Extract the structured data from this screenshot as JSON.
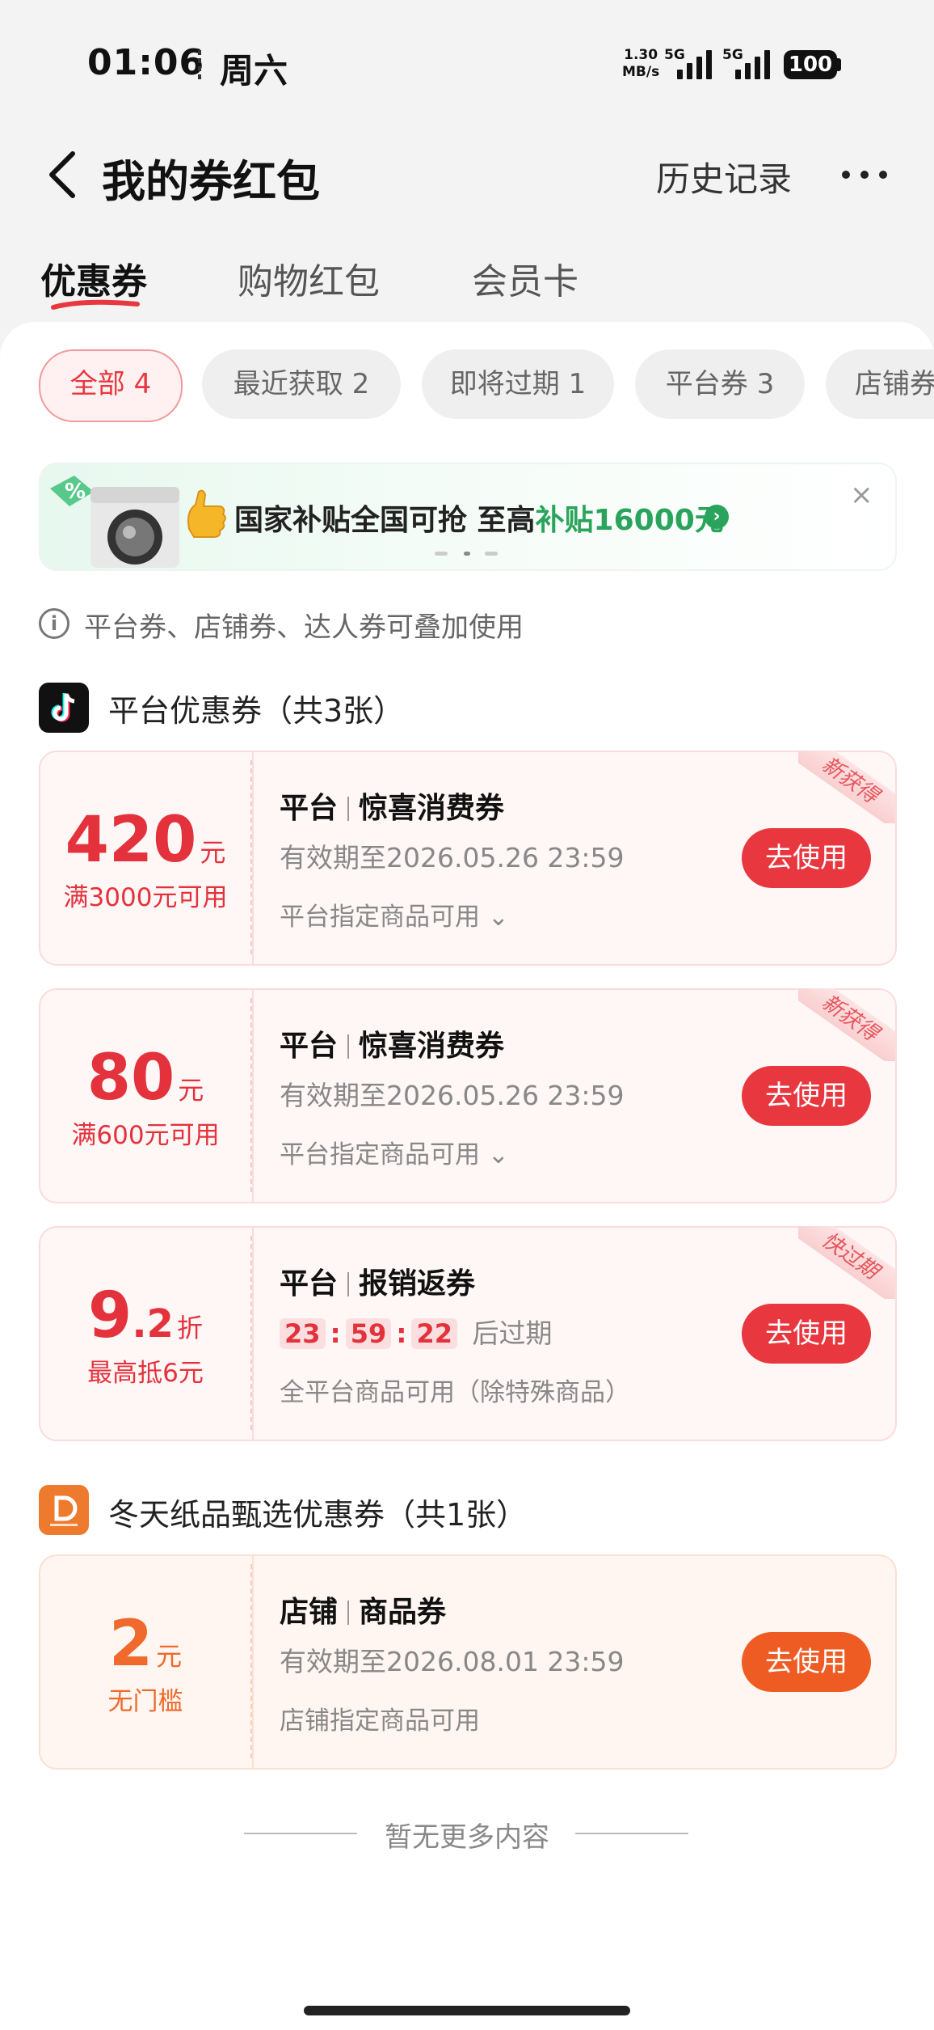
{
  "status": {
    "time": "01:06",
    "day": "周六",
    "speed_value": "1.30",
    "speed_unit": "MB/s",
    "sim1": "5G",
    "sim2": "5G",
    "battery": "100"
  },
  "header": {
    "title": "我的券红包",
    "history": "历史记录"
  },
  "tabs": [
    {
      "label": "优惠券"
    },
    {
      "label": "购物红包"
    },
    {
      "label": "会员卡"
    }
  ],
  "filters": [
    {
      "label": "全部 4"
    },
    {
      "label": "最近获取 2"
    },
    {
      "label": "即将过期 1"
    },
    {
      "label": "平台券 3"
    },
    {
      "label": "店铺券"
    }
  ],
  "banner": {
    "text_main": "国家补贴全国可抢 至高",
    "text_highlight": "补贴16000元",
    "close": "×"
  },
  "tip": "平台券、店铺券、达人券可叠加使用",
  "sections": [
    {
      "title": "平台优惠券（共3张）",
      "coupons": [
        {
          "amount": "420",
          "unit": "元",
          "condition": "满3000元可用",
          "type": "平台",
          "name": "惊喜消费券",
          "valid": "有效期至2026.05.26 23:59",
          "scope": "平台指定商品可用",
          "tag": "新获得",
          "button": "去使用"
        },
        {
          "amount": "80",
          "unit": "元",
          "condition": "满600元可用",
          "type": "平台",
          "name": "惊喜消费券",
          "valid": "有效期至2026.05.26 23:59",
          "scope": "平台指定商品可用",
          "tag": "新获得",
          "button": "去使用"
        },
        {
          "amount_int": "9",
          "amount_dec": ".2",
          "unit": "折",
          "condition": "最高抵6元",
          "type": "平台",
          "name": "报销返券",
          "countdown": [
            "23",
            "59",
            "22"
          ],
          "countdown_suffix": "后过期",
          "scope": "全平台商品可用（除特殊商品）",
          "tag": "快过期",
          "button": "去使用"
        }
      ]
    },
    {
      "title": "冬天纸品甄选优惠券（共1张）",
      "coupons": [
        {
          "amount": "2",
          "unit": "元",
          "condition": "无门槛",
          "type": "店铺",
          "name": "商品券",
          "valid": "有效期至2026.08.01 23:59",
          "scope": "店铺指定商品可用",
          "button": "去使用"
        }
      ]
    }
  ],
  "footer": {
    "no_more": "暂无更多内容"
  },
  "colors": {
    "accent_red": "#e8373f",
    "accent_orange": "#ee5c24",
    "banner_green": "#2aa45c"
  }
}
